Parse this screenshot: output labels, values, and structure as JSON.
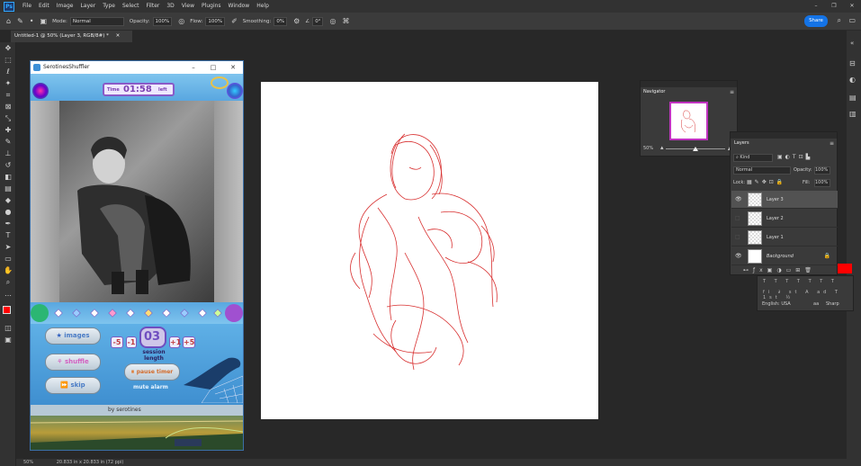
{
  "menubar": {
    "app_badge": "Ps",
    "items": [
      "File",
      "Edit",
      "Image",
      "Layer",
      "Type",
      "Select",
      "Filter",
      "3D",
      "View",
      "Plugins",
      "Window",
      "Help"
    ]
  },
  "options": {
    "mode_label": "Mode:",
    "mode_value": "Normal",
    "opacity_label": "Opacity:",
    "opacity_value": "100%",
    "flow_label": "Flow:",
    "flow_value": "100%",
    "smoothing_label": "Smoothing:",
    "smoothing_value": "0%",
    "angle_value": "0°",
    "share_label": "Share"
  },
  "document": {
    "tab_title": "Untitled-1 @ 50% (Layer 3, RGB/8#) *"
  },
  "status": {
    "zoom": "50%",
    "info": "20.833 in x 20.833 in (72 ppi)"
  },
  "navigator": {
    "title": "Navigator",
    "zoom": "50%"
  },
  "layers": {
    "title": "Layers",
    "kind_label": "Kind",
    "blend_mode": "Normal",
    "opacity_label": "Opacity:",
    "opacity_value": "100%",
    "lock_label": "Lock:",
    "fill_label": "Fill:",
    "fill_value": "100%",
    "items": [
      {
        "name": "Layer 3",
        "visible": true
      },
      {
        "name": "Layer 2",
        "visible": false
      },
      {
        "name": "Layer 1",
        "visible": false
      },
      {
        "name": "Background",
        "visible": true
      }
    ]
  },
  "character": {
    "language": "English: USA",
    "aa_label": "aa",
    "aa_value": "Sharp"
  },
  "shuffler": {
    "window_title": "SerotinesShuffler",
    "time_label": "Time",
    "time_value": "01:58",
    "left_label": "left",
    "images_label": "images",
    "shuffle_label": "shuffle",
    "skip_label": "skip",
    "minus5": "-5",
    "minus1": "-1",
    "session_count": "03",
    "session_label": "session length",
    "plus1": "+1",
    "plus5": "+5",
    "pause_label": "pause timer",
    "mute_label": "mute alarm",
    "credit": "by serotines"
  },
  "colors": {
    "foreground": "#ff0000",
    "background": "#000000",
    "accent": "#1473e6"
  }
}
